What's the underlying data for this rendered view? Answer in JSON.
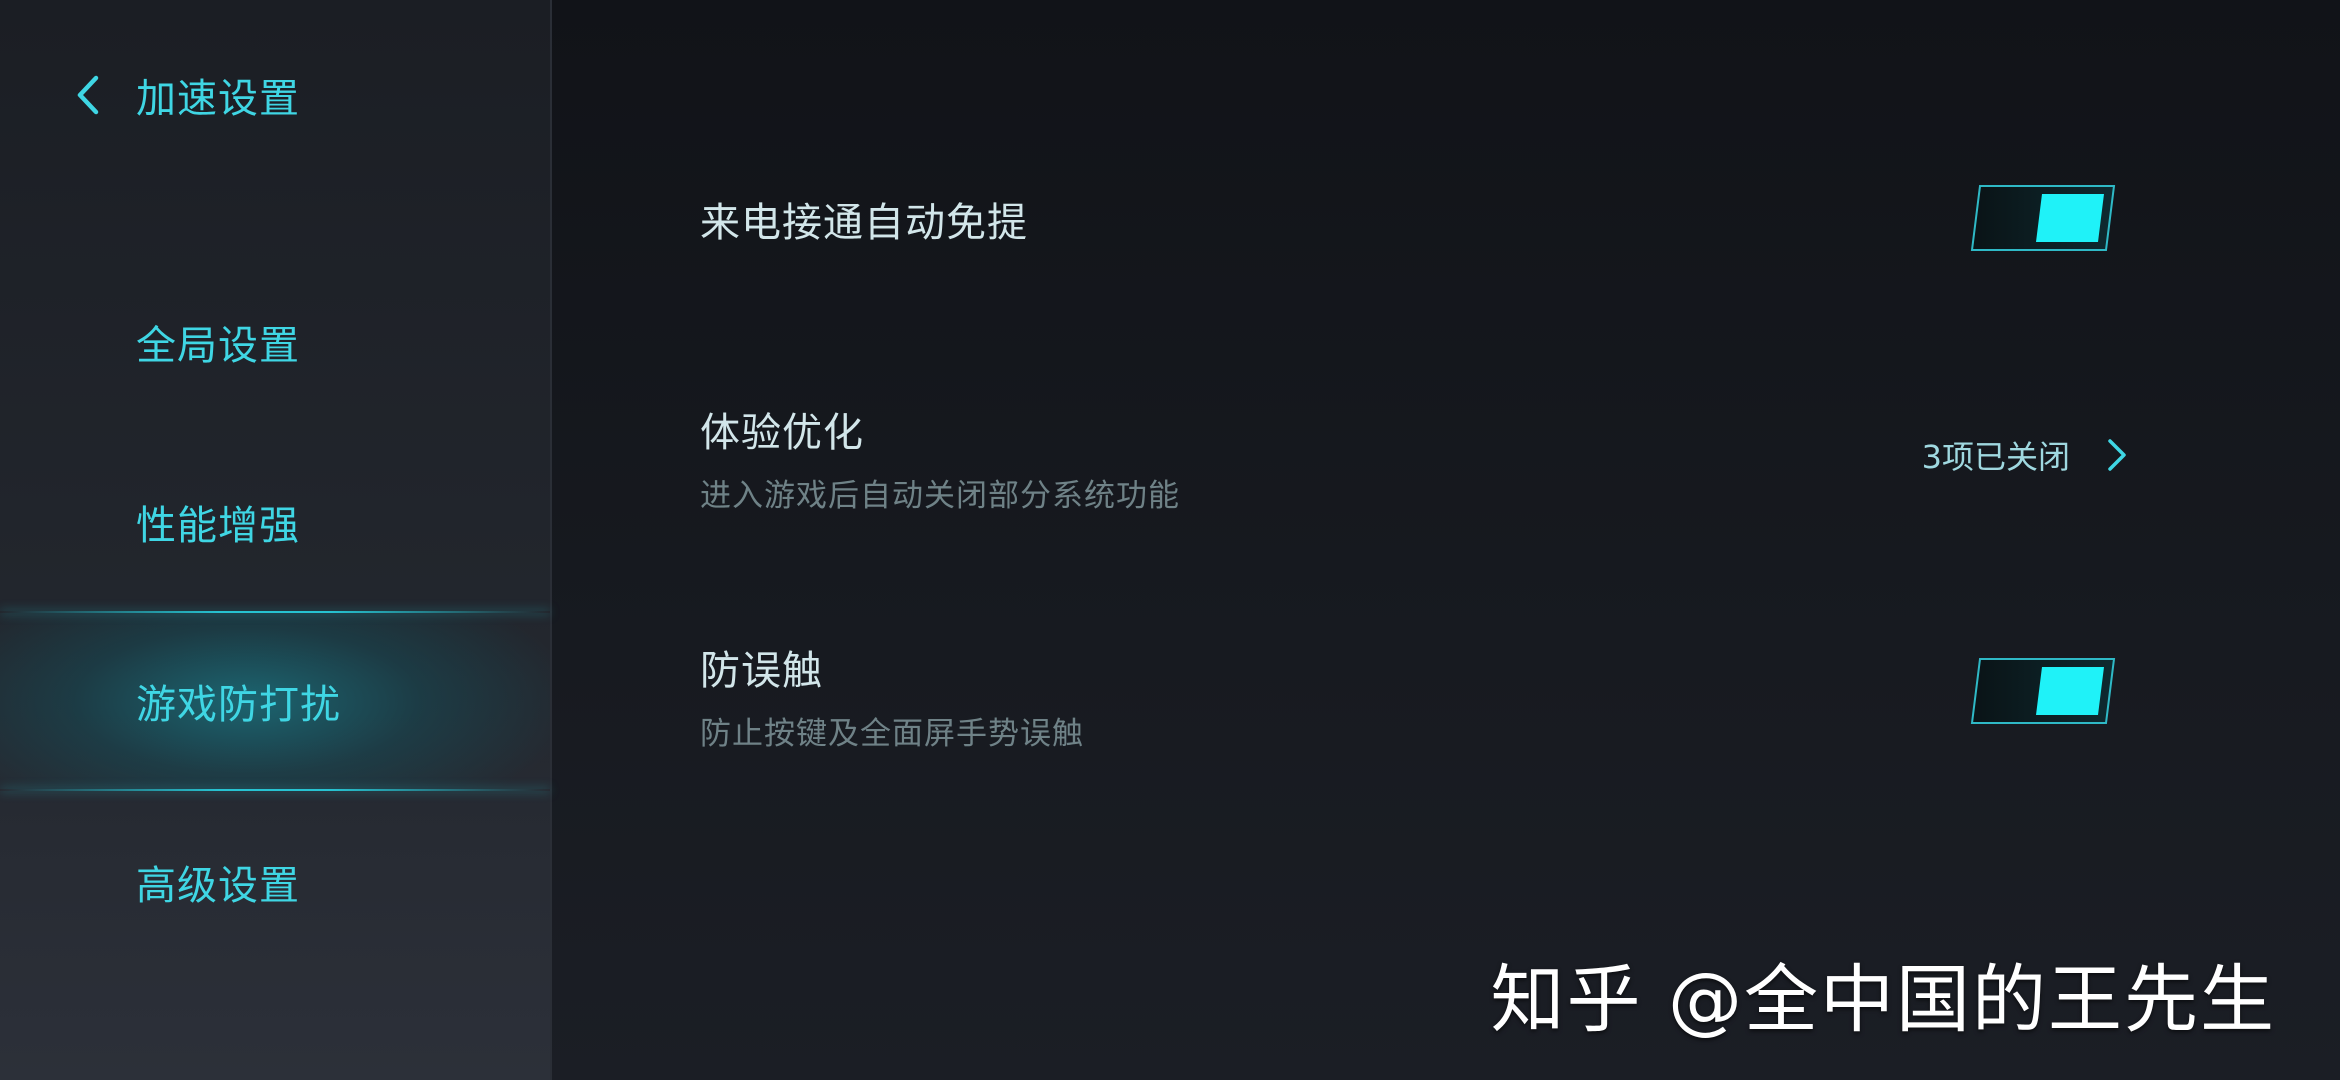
{
  "sidebar": {
    "back_label": "加速设置",
    "items": [
      {
        "label": "全局设置",
        "active": false
      },
      {
        "label": "性能增强",
        "active": false
      },
      {
        "label": "游戏防打扰",
        "active": true
      },
      {
        "label": "高级设置",
        "active": false
      }
    ]
  },
  "settings": [
    {
      "title": "来电接通自动免提",
      "subtitle": "",
      "control": "toggle",
      "on": true
    },
    {
      "title": "体验优化",
      "subtitle": "进入游戏后自动关闭部分系统功能",
      "control": "link",
      "value": "3项已关闭"
    },
    {
      "title": "防误触",
      "subtitle": "防止按键及全面屏手势误触",
      "control": "toggle",
      "on": true
    }
  ],
  "watermark": "知乎 @全中国的王先生",
  "icons": {
    "back": "chevron-left-icon",
    "detail": "chevron-right-icon"
  },
  "colors": {
    "accent": "#3fd6e4",
    "toggle_knob": "#1ff2f8"
  }
}
